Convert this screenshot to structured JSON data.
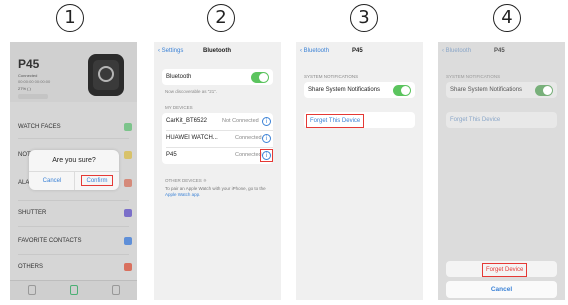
{
  "steps": [
    "1",
    "2",
    "3",
    "4"
  ],
  "panel1": {
    "device_name": "P45",
    "status_lines": [
      "Connected",
      "00:00:00 00:00:00",
      "27% ( )"
    ],
    "sections": [
      "WATCH FACES",
      "NOT",
      "ALA",
      "SHUTTER",
      "FAVORITE CONTACTS",
      "OTHERS"
    ],
    "dialog": {
      "title": "Are you sure?",
      "cancel": "Cancel",
      "confirm": "Confirm"
    }
  },
  "panel2": {
    "back_label": "Settings",
    "title": "Bluetooth",
    "bluetooth_label": "Bluetooth",
    "discoverable": "Now discoverable as “21”.",
    "my_devices_header": "MY DEVICES",
    "devices": [
      {
        "name": "CarKit_BT6522",
        "status": "Not Connected"
      },
      {
        "name": "HUAWEI WATCH...",
        "status": "Connected"
      },
      {
        "name": "P45",
        "status": "Connected"
      }
    ],
    "other_devices_header": "OTHER DEVICES",
    "pair_text": "To pair an Apple Watch with your iPhone, go to the",
    "pair_link": "Apple Watch app."
  },
  "panel3": {
    "back_label": "Bluetooth",
    "title": "P45",
    "section_header": "SYSTEM NOTIFICATIONS",
    "share_label": "Share System Notifications",
    "forget_label": "Forget This Device"
  },
  "panel4": {
    "back_label": "Bluetooth",
    "title": "P45",
    "section_header": "SYSTEM NOTIFICATIONS",
    "share_label": "Share System Notifications",
    "forget_label": "Forget This Device",
    "sheet_forget": "Forget Device",
    "sheet_cancel": "Cancel"
  },
  "colors": {
    "ios_blue": "#3b82d6",
    "toggle_green": "#5bc45e",
    "highlight_red": "#e53935"
  }
}
